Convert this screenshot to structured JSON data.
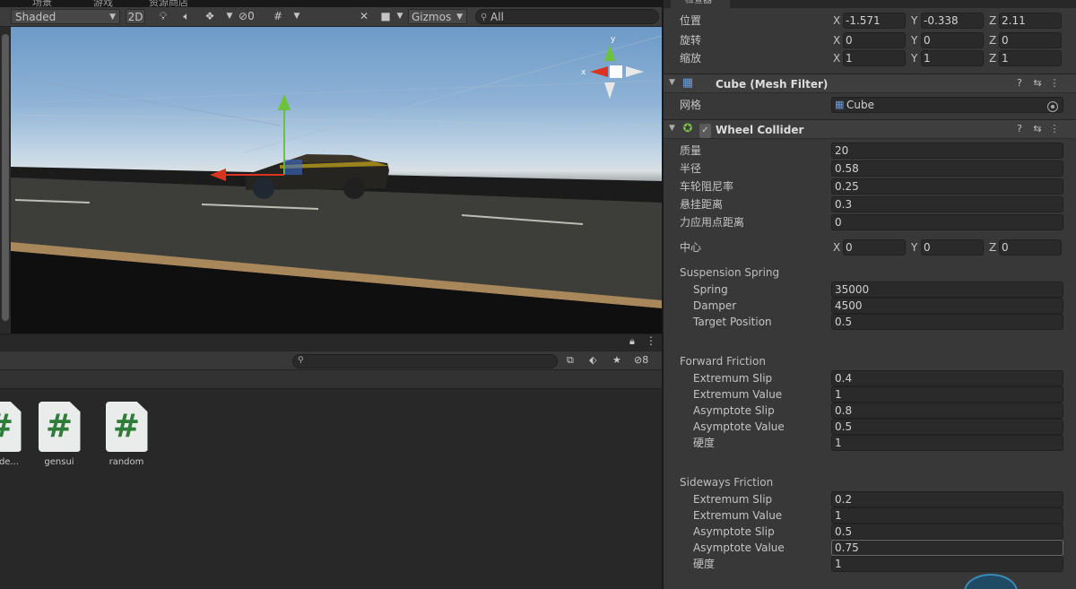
{
  "tabs": {
    "scene": "场景",
    "game": "游戏",
    "asset_store": "资源商店"
  },
  "scene_toolbar": {
    "shading_mode": "Shaded",
    "mode_2d": "2D",
    "hidden_count": "0",
    "gizmos_label": "Gizmos",
    "search_placeholder": "All"
  },
  "project": {
    "hidden_count": "8",
    "assets": [
      {
        "name": "de..."
      },
      {
        "name": "gensui"
      },
      {
        "name": "random"
      }
    ]
  },
  "inspector": {
    "tab_label": "检查器",
    "transform": {
      "position": {
        "label": "位置",
        "x": "-1.571",
        "y": "-0.338",
        "z": "2.11"
      },
      "rotation": {
        "label": "旋转",
        "x": "0",
        "y": "0",
        "z": "0"
      },
      "scale": {
        "label": "缩放",
        "x": "1",
        "y": "1",
        "z": "1"
      }
    },
    "mesh_filter": {
      "title": "Cube (Mesh Filter)",
      "mesh_label": "网格",
      "mesh_value": "Cube"
    },
    "wheel_collider": {
      "title": "Wheel Collider",
      "mass": {
        "label": "质量",
        "value": "20"
      },
      "radius": {
        "label": "半径",
        "value": "0.58"
      },
      "wheel_damping": {
        "label": "车轮阻尼率",
        "value": "0.25"
      },
      "suspension_distance": {
        "label": "悬挂距离",
        "value": "0.3"
      },
      "force_app_distance": {
        "label": "力应用点距离",
        "value": "0"
      },
      "center": {
        "label": "中心",
        "x": "0",
        "y": "0",
        "z": "0"
      },
      "suspension_spring": {
        "title": "Suspension Spring",
        "spring": {
          "label": "Spring",
          "value": "35000"
        },
        "damper": {
          "label": "Damper",
          "value": "4500"
        },
        "target_position": {
          "label": "Target Position",
          "value": "0.5"
        }
      },
      "forward_friction": {
        "title": "Forward Friction",
        "extremum_slip": {
          "label": "Extremum Slip",
          "value": "0.4"
        },
        "extremum_value": {
          "label": "Extremum Value",
          "value": "1"
        },
        "asymptote_slip": {
          "label": "Asymptote Slip",
          "value": "0.8"
        },
        "asymptote_value": {
          "label": "Asymptote Value",
          "value": "0.5"
        },
        "stiffness": {
          "label": "硬度",
          "value": "1"
        }
      },
      "sideways_friction": {
        "title": "Sideways Friction",
        "extremum_slip": {
          "label": "Extremum Slip",
          "value": "0.2"
        },
        "extremum_value": {
          "label": "Extremum Value",
          "value": "1"
        },
        "asymptote_slip": {
          "label": "Asymptote Slip",
          "value": "0.5"
        },
        "asymptote_value": {
          "label": "Asymptote Value",
          "value": "0.75"
        },
        "stiffness": {
          "label": "硬度",
          "value": "1"
        }
      }
    }
  },
  "colors": {
    "axis_x": "#d9341f",
    "axis_y": "#6ec23a",
    "axis_z": "#3a6fd8",
    "script_icon": "#2e7b3a",
    "collider_icon": "#7cc04a"
  },
  "icons": {
    "script": "csharp-script-icon",
    "lock": "lock-icon",
    "menu": "kebab-menu-icon",
    "help": "help-icon",
    "preset": "preset-icon",
    "search": "search-icon"
  }
}
